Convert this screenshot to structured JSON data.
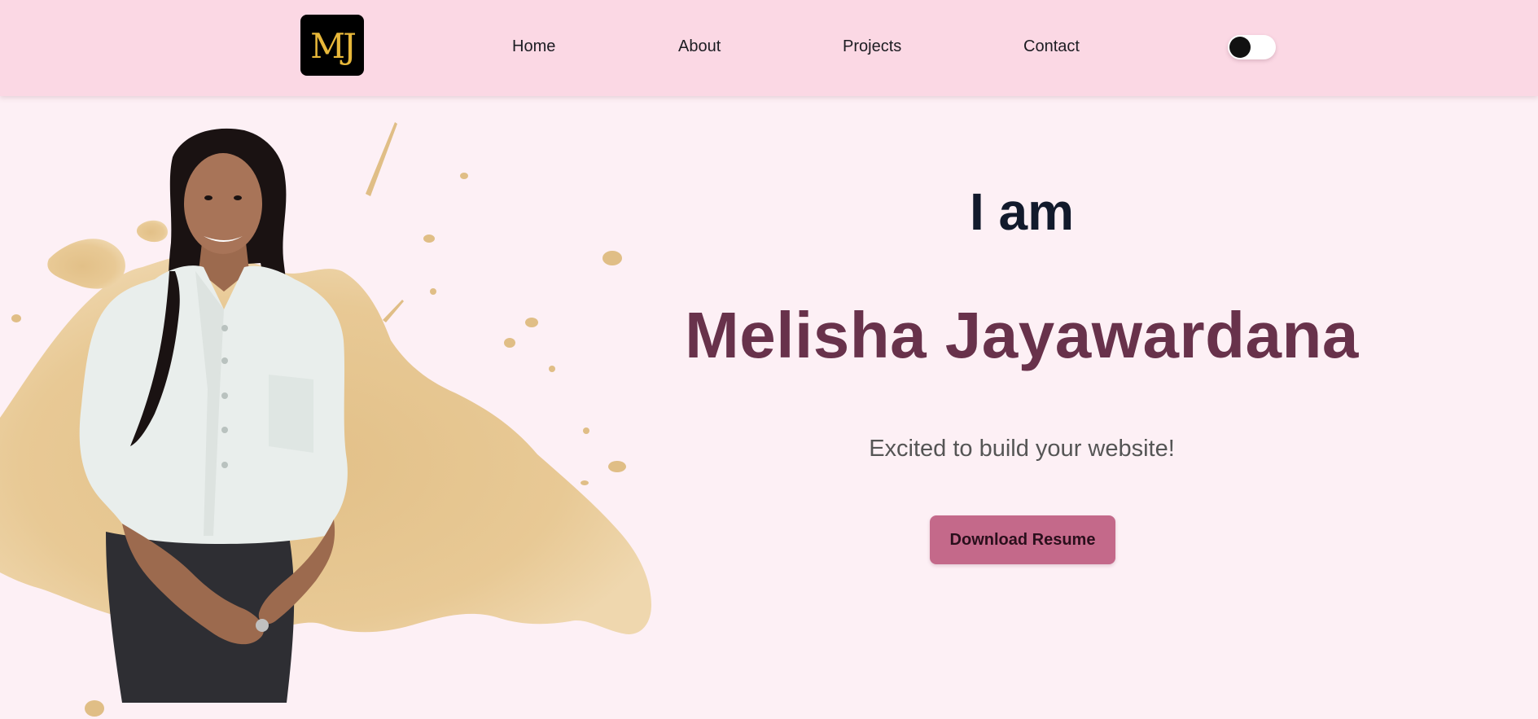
{
  "header": {
    "logo_text": "MJ",
    "nav": [
      {
        "label": "Home"
      },
      {
        "label": "About"
      },
      {
        "label": "Projects"
      },
      {
        "label": "Contact"
      }
    ],
    "theme_toggle": {
      "state": "off"
    }
  },
  "hero": {
    "intro": "I am",
    "name": "Melisha Jayawardana",
    "tagline": "Excited to build your website!",
    "button_label": "Download Resume"
  },
  "colors": {
    "header_bg": "#fbd8e4",
    "page_bg": "#fdf0f5",
    "logo_bg": "#000000",
    "logo_text": "#e8b83a",
    "intro_text": "#121a2c",
    "name_text": "#68324b",
    "tagline_text": "#555555",
    "button_bg": "#c4698a",
    "splash": "#e6c58e"
  },
  "icons": {
    "theme_toggle": "toggle-switch-icon"
  }
}
